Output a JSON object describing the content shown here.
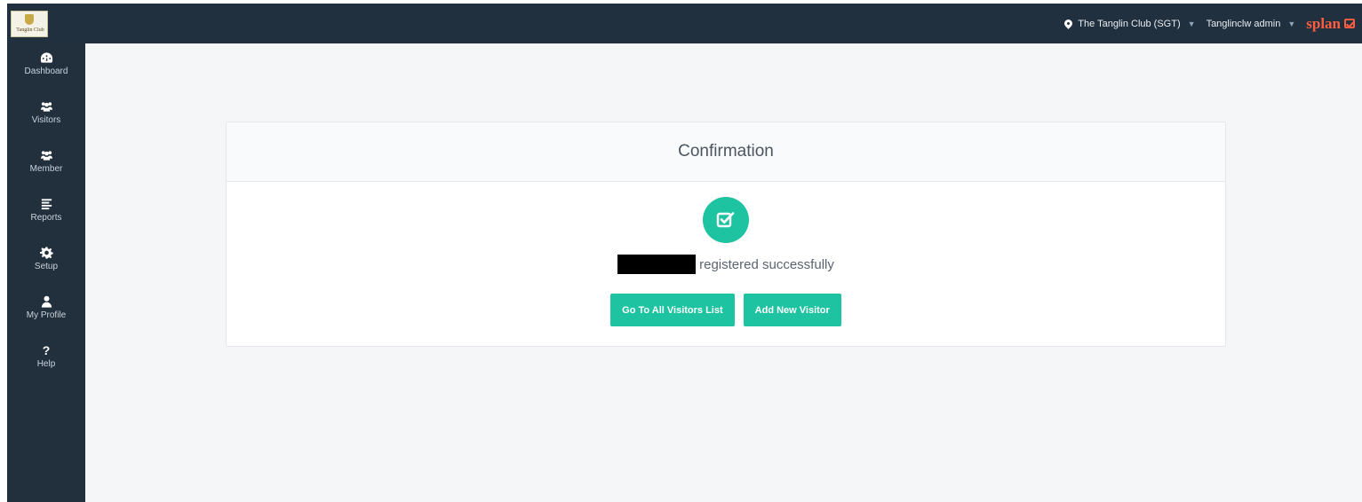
{
  "header": {
    "logo_text": "Tanglin Club",
    "location": "The Tanglin Club (SGT)",
    "user": "Tanglinclw admin",
    "brand": "splan"
  },
  "sidebar": {
    "items": [
      {
        "label": "Dashboard",
        "icon": "dashboard-icon"
      },
      {
        "label": "Visitors",
        "icon": "users-icon"
      },
      {
        "label": "Member",
        "icon": "users-icon"
      },
      {
        "label": "Reports",
        "icon": "list-icon"
      },
      {
        "label": "Setup",
        "icon": "gear-icon"
      },
      {
        "label": "My Profile",
        "icon": "user-icon"
      },
      {
        "label": "Help",
        "icon": "question-icon"
      }
    ]
  },
  "card": {
    "title": "Confirmation",
    "message": "registered successfully",
    "buttons": {
      "visitors_list": "Go To All Visitors List",
      "add_visitor": "Add New Visitor"
    }
  },
  "colors": {
    "topbar": "#21303f",
    "sidebar": "#22303e",
    "accent": "#1ec4a1",
    "brand": "#ff5d40",
    "background": "#f5f6f8"
  }
}
